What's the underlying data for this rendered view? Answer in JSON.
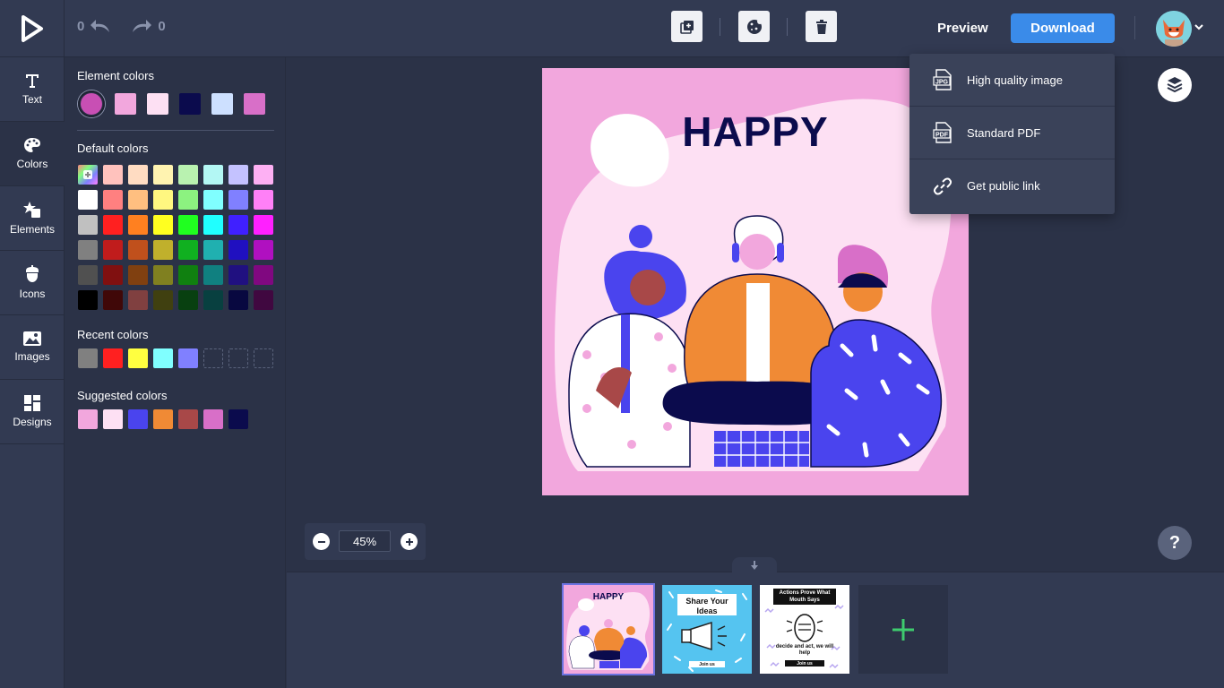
{
  "history": {
    "undo_count": "0",
    "redo_count": "0"
  },
  "toolbar": {
    "preview_label": "Preview",
    "download_label": "Download"
  },
  "download_menu": [
    {
      "label": "High quality image",
      "icon": "jpg-file-icon"
    },
    {
      "label": "Standard PDF",
      "icon": "pdf-file-icon"
    },
    {
      "label": "Get public link",
      "icon": "link-icon"
    }
  ],
  "rail": [
    {
      "label": "Text",
      "icon": "text-icon"
    },
    {
      "label": "Colors",
      "icon": "palette-icon"
    },
    {
      "label": "Elements",
      "icon": "elements-icon"
    },
    {
      "label": "Icons",
      "icon": "acorn-icon"
    },
    {
      "label": "Images",
      "icon": "image-icon"
    },
    {
      "label": "Designs",
      "icon": "grid-icon"
    }
  ],
  "panel": {
    "element_title": "Element colors",
    "element_colors": [
      "#c84fb4",
      "#f2a7dd",
      "#fde0f3",
      "#0b0b4d",
      "#cde0ff",
      "#d86fc8"
    ],
    "default_title": "Default colors",
    "default_colors": [
      [
        "custom",
        "#ffc2bd",
        "#ffdcc2",
        "#fff3b0",
        "#b9f2b0",
        "#b3f7f4",
        "#c4c2ff",
        "#fdb0f3"
      ],
      [
        "#ffffff",
        "#ff8080",
        "#ffbf80",
        "#fff780",
        "#8cf280",
        "#80ffff",
        "#8080ff",
        "#ff80f7"
      ],
      [
        "#c0c0c0",
        "#ff2020",
        "#ff8020",
        "#ffff20",
        "#20ff20",
        "#20ffff",
        "#4020ff",
        "#ff20ff"
      ],
      [
        "#808080",
        "#c01c1c",
        "#c0501c",
        "#c0b02c",
        "#10b020",
        "#20b0b0",
        "#2010c0",
        "#b010c0"
      ],
      [
        "#505050",
        "#801010",
        "#804010",
        "#808020",
        "#108010",
        "#108080",
        "#201080",
        "#800880"
      ],
      [
        "#000000",
        "#400808",
        "#804040",
        "#404010",
        "#084010",
        "#084040",
        "#080840",
        "#400840"
      ]
    ],
    "recent_title": "Recent colors",
    "recent_colors": [
      "#808080",
      "#ff2020",
      "#ffff40",
      "#80ffff",
      "#8080ff"
    ],
    "suggested_title": "Suggested colors",
    "suggested_colors": [
      "#f2a7dd",
      "#fde0f3",
      "#4a44ee",
      "#f08a35",
      "#a84848",
      "#d86fc8",
      "#0b0b4d"
    ]
  },
  "canvas": {
    "title": "HAPPY"
  },
  "zoom": {
    "value": "45%"
  },
  "pages": [
    {
      "title": "HAPPY"
    },
    {
      "title": "Share Your Ideas",
      "footer": "Join us"
    },
    {
      "title": "Actions Prove What Mouth Says",
      "subtitle": "decide and act, we will help",
      "footer": "Join us"
    }
  ],
  "colors": {
    "accent": "#3a8be9",
    "add": "#3ecb6e"
  }
}
